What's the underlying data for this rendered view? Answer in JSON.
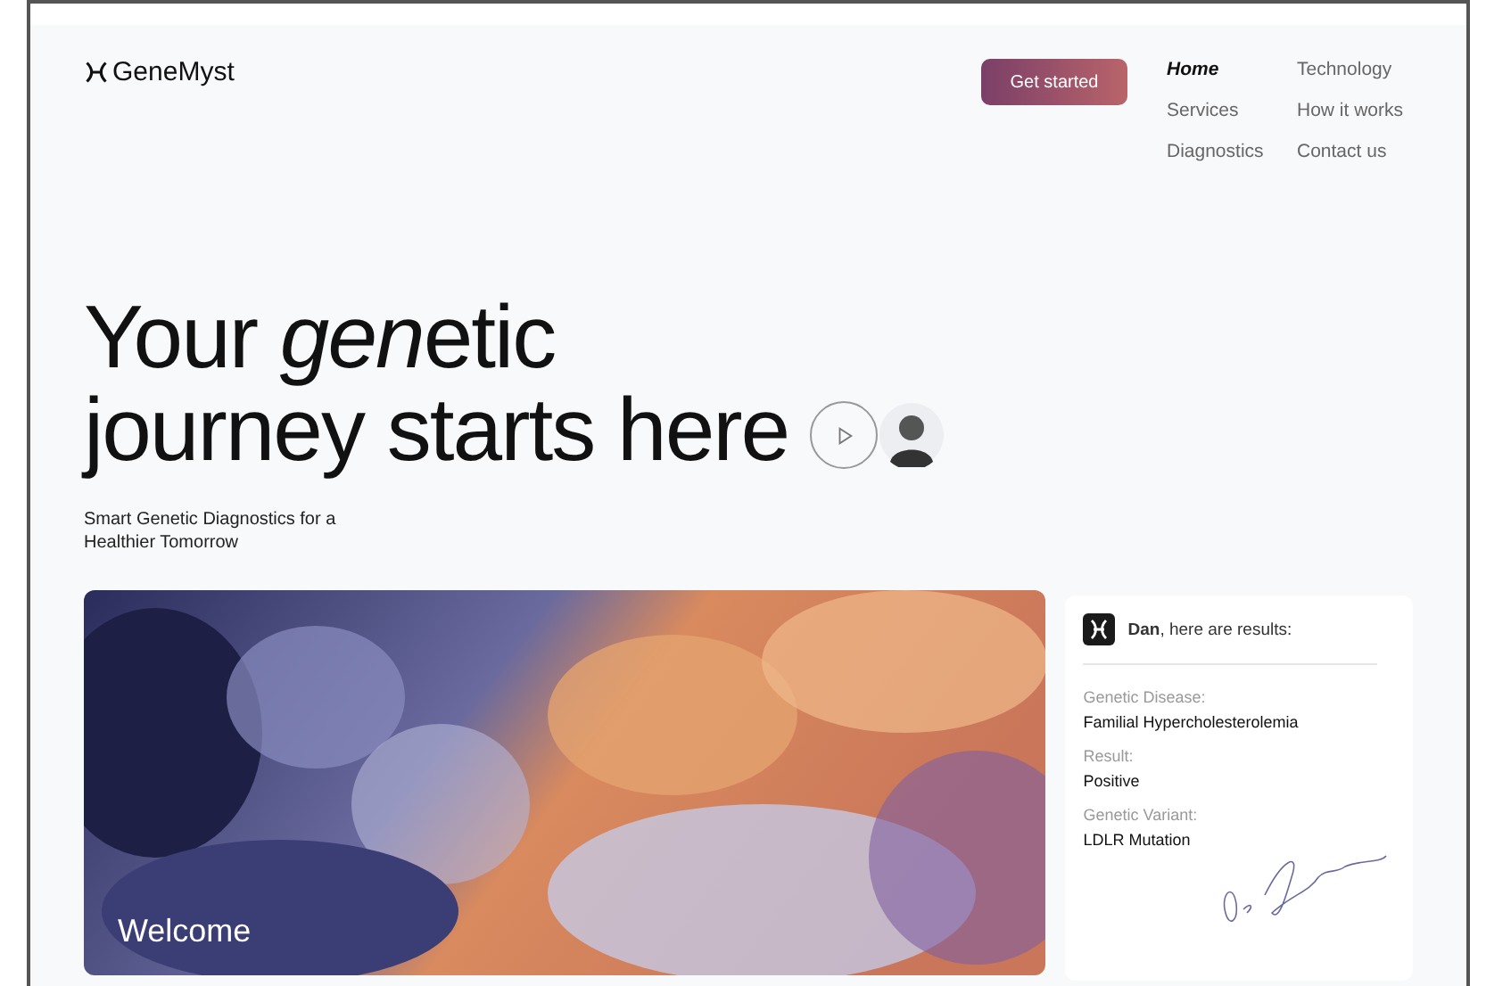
{
  "brand": {
    "name": "GeneMyst"
  },
  "cta": {
    "label": "Get started"
  },
  "nav": [
    {
      "label": "Home",
      "selected": true
    },
    {
      "label": "Technology",
      "selected": false
    },
    {
      "label": "Services",
      "selected": false
    },
    {
      "label": "How it works",
      "selected": false
    },
    {
      "label": "Diagnostics",
      "selected": false
    },
    {
      "label": "Contact us",
      "selected": false
    }
  ],
  "hero": {
    "headline_line_1": [
      {
        "text": "Your ",
        "italic": false
      },
      {
        "text": "gen",
        "italic": true
      },
      {
        "text": "etic",
        "italic": false
      }
    ],
    "headline_line_2": "journey starts here",
    "subtitle": "Smart Genetic Diagnostics for a Healthier Tomorrow"
  },
  "banner": {
    "caption": "Welcome"
  },
  "results_card": {
    "greeting": "**Dan**, here are results:",
    "fields": [
      {
        "label": "Genetic Disease:",
        "value": "Familial Hypercholesterolemia"
      },
      {
        "label": "Result:",
        "value": "Positive"
      },
      {
        "label": "Genetic Variant:",
        "value": "LDLR Mutation"
      }
    ]
  }
}
